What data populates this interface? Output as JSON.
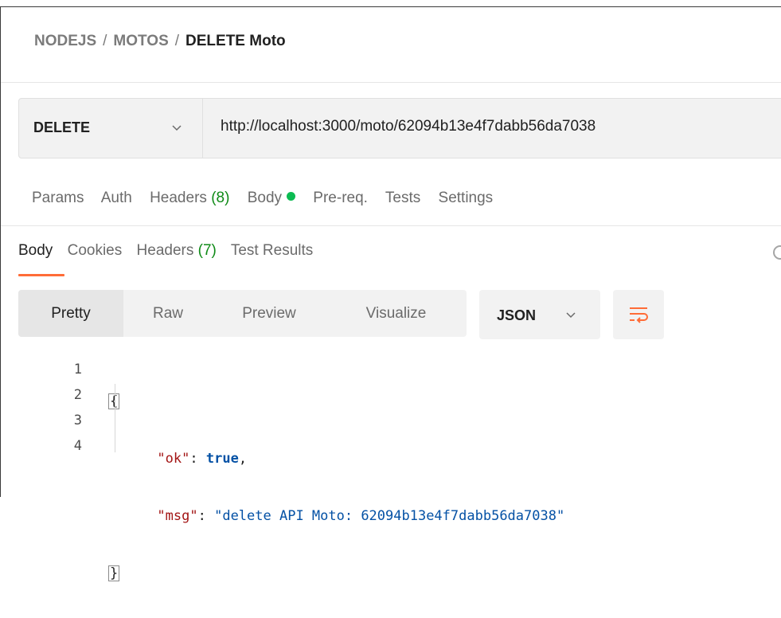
{
  "breadcrumb": {
    "items": [
      "NODEJS",
      "MOTOS"
    ],
    "separator": "/",
    "current": "DELETE Moto"
  },
  "request": {
    "method": "DELETE",
    "url": "http://localhost:3000/moto/62094b13e4f7dabb56da7038"
  },
  "request_tabs": {
    "params": "Params",
    "auth": "Auth",
    "headers": "Headers",
    "headers_count": "(8)",
    "body": "Body",
    "prereq": "Pre-req.",
    "tests": "Tests",
    "settings": "Settings"
  },
  "response_tabs": {
    "body": "Body",
    "cookies": "Cookies",
    "headers": "Headers",
    "headers_count": "(7)",
    "test_results": "Test Results"
  },
  "view_modes": {
    "pretty": "Pretty",
    "raw": "Raw",
    "preview": "Preview",
    "visualize": "Visualize",
    "selected": "Pretty"
  },
  "format": {
    "selected": "JSON"
  },
  "code": {
    "line_numbers": [
      "1",
      "2",
      "3",
      "4"
    ],
    "open_brace": "{",
    "close_brace": "}",
    "key_ok": "\"ok\"",
    "val_ok": "true",
    "key_msg": "\"msg\"",
    "val_msg": "\"delete API Moto: 62094b13e4f7dabb56da7038\"",
    "colon": ": ",
    "comma": ","
  },
  "colors": {
    "accent": "#ff6c37",
    "green_count": "#0e8a16",
    "status_dot": "#0cbb52",
    "json_key": "#a31515",
    "json_value": "#0451a5"
  }
}
